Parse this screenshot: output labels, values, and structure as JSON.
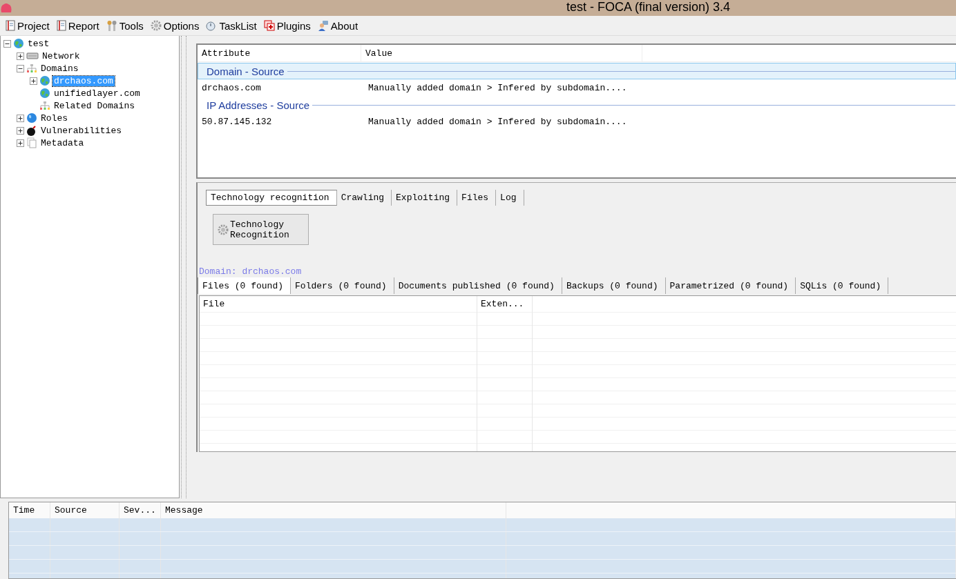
{
  "window": {
    "title": "test - FOCA (final version) 3.4"
  },
  "menu": [
    {
      "label": "Project",
      "kind": "project"
    },
    {
      "label": "Report",
      "kind": "report"
    },
    {
      "label": "Tools",
      "kind": "tools"
    },
    {
      "label": "Options",
      "kind": "options"
    },
    {
      "label": "TaskList",
      "kind": "tasklist"
    },
    {
      "label": "Plugins",
      "kind": "plugins"
    },
    {
      "label": "About",
      "kind": "about"
    }
  ],
  "tree": [
    {
      "label": "test",
      "kind": "globe",
      "expanded": true,
      "selected": false,
      "children": [
        {
          "label": "Network",
          "kind": "server",
          "expanded": false,
          "selected": false
        },
        {
          "label": "Domains",
          "kind": "sitemap",
          "expanded": true,
          "selected": false,
          "children": [
            {
              "label": "drchaos.com",
              "kind": "globe",
              "expanded": false,
              "selected": true
            },
            {
              "label": "unifiedlayer.com",
              "kind": "globe",
              "selected": false
            },
            {
              "label": "Related Domains",
              "kind": "sitemap",
              "selected": false
            }
          ]
        },
        {
          "label": "Roles",
          "kind": "earth",
          "expanded": false,
          "selected": false
        },
        {
          "label": "Vulnerabilities",
          "kind": "bomb",
          "expanded": false,
          "selected": false
        },
        {
          "label": "Metadata",
          "kind": "documents",
          "expanded": false,
          "selected": false
        }
      ]
    }
  ],
  "attributes": {
    "columns": [
      "Attribute",
      "Value"
    ],
    "groups": [
      {
        "title": "Domain - Source",
        "selected": true,
        "rows": [
          {
            "attribute": "drchaos.com",
            "value": "Manually added domain > Infered by subdomain...."
          }
        ]
      },
      {
        "title": "IP Addresses - Source",
        "selected": false,
        "rows": [
          {
            "attribute": "50.87.145.132",
            "value": "Manually added domain > Infered by subdomain...."
          }
        ]
      }
    ]
  },
  "tabs": [
    {
      "label": "Technology recognition",
      "selected": true
    },
    {
      "label": "Crawling",
      "selected": false
    },
    {
      "label": "Exploiting",
      "selected": false
    },
    {
      "label": "Files",
      "selected": false
    },
    {
      "label": "Log",
      "selected": false
    }
  ],
  "action_button": {
    "label": "Technology\nRecognition"
  },
  "domain_label": "Domain: drchaos.com",
  "result_tabs": [
    {
      "label": "Files (0 found)",
      "selected": true
    },
    {
      "label": "Folders (0 found)",
      "selected": false
    },
    {
      "label": "Documents published (0 found)",
      "selected": false
    },
    {
      "label": "Backups (0 found)",
      "selected": false
    },
    {
      "label": "Parametrized (0 found)",
      "selected": false
    },
    {
      "label": "SQLis (0 found)",
      "selected": false
    }
  ],
  "files_table": {
    "columns": [
      "File",
      "Exten..."
    ]
  },
  "log_table": {
    "columns": [
      "Time",
      "Source",
      "Sev...",
      "Message"
    ]
  }
}
